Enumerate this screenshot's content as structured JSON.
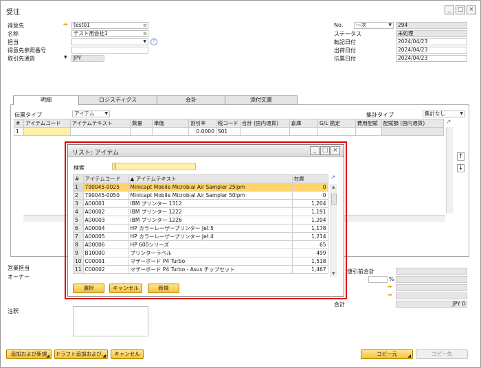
{
  "window": {
    "title": "受注"
  },
  "header_left": {
    "customer_label": "得意先",
    "customer_value": "test01",
    "name_label": "名称",
    "name_value": "テスト用会社1",
    "contact_label": "担当",
    "ref_label": "得意先参照番号",
    "currency_label": "取引先通貨",
    "currency_value": "JPY"
  },
  "header_right": {
    "no_label": "No.",
    "series_value": "一次",
    "no_value": "294",
    "status_label": "ステータス",
    "status_value": "未処理",
    "posting_label": "転記日付",
    "posting_value": "2024/04/23",
    "delivery_label": "出荷日付",
    "delivery_value": "2024/04/23",
    "doc_label": "伝票日付",
    "doc_value": "2024/04/23"
  },
  "tabs": [
    "明細",
    "ロジスティクス",
    "会計",
    "添付文書"
  ],
  "lines": {
    "doc_type_label": "伝票タイプ",
    "doc_type_value": "アイテム",
    "summary_label": "集計タイプ",
    "summary_value": "集計なし",
    "columns": [
      "#",
      "アイテムコード",
      "アイテムテキスト",
      "数量",
      "単価",
      "割引率",
      "税コード",
      "合計 (国内通貨)",
      "倉庫",
      "G/L 勘定",
      "費用配賦",
      "配賦額 (国内通貨)"
    ],
    "row": {
      "index": "1",
      "discount": "0.0000",
      "tax": "S01"
    }
  },
  "footer_left": {
    "sales_label": "営業担当",
    "owner_label": "オーナー",
    "remarks_label": "注釈"
  },
  "footer_right": {
    "total_before_label": "値引前合計",
    "pct": "%",
    "total_label": "合計",
    "total_value": "JPY 0"
  },
  "bottom_buttons": {
    "add_new": "追加および新規",
    "add_draft": "ドラフト追加および...",
    "cancel": "キャンセル",
    "copy_from": "コピー元",
    "copy_to": "コピー先"
  },
  "modal": {
    "title": "リスト: アイテム",
    "search_label": "検索",
    "columns": [
      "#",
      "アイテムコード",
      "アイテムテキスト",
      "在庫"
    ],
    "rows": [
      {
        "i": "1",
        "code": "790045-0025",
        "text": "Minicapt Mobile Microbial Air Sampler 25lpm",
        "stock": "0"
      },
      {
        "i": "2",
        "code": "790045-0050",
        "text": "Minicapt Mobile Microbial Air Sampler 50lpm",
        "stock": "0"
      },
      {
        "i": "3",
        "code": "A00001",
        "text": "IBM プリンター 1312",
        "stock": "1,204"
      },
      {
        "i": "4",
        "code": "A00002",
        "text": "IBM プリンター 1222",
        "stock": "1,191"
      },
      {
        "i": "5",
        "code": "A00003",
        "text": "IBM プリンター 1226",
        "stock": "1,204"
      },
      {
        "i": "6",
        "code": "A00004",
        "text": "HP カラーレーザープリンター Jet 5",
        "stock": "1,178"
      },
      {
        "i": "7",
        "code": "A00005",
        "text": "HP カラーレーザープリンター Jet 4",
        "stock": "1,214"
      },
      {
        "i": "8",
        "code": "A00006",
        "text": "HP 600シリーズ",
        "stock": "65"
      },
      {
        "i": "9",
        "code": "B10000",
        "text": "プリンターラベル",
        "stock": "499"
      },
      {
        "i": "10",
        "code": "C00001",
        "text": "マザーボード P4 Turbo",
        "stock": "1,518"
      },
      {
        "i": "11",
        "code": "C00002",
        "text": "マザーボード P4 Turbo - Asus チップセット",
        "stock": "1,467"
      }
    ],
    "buttons": {
      "select": "選択",
      "cancel": "キャンセル",
      "new": "新規"
    }
  },
  "colors": {
    "accent_yellow": "#f6c23d",
    "highlight_red": "#e00000",
    "selected_row": "#ffd46b"
  }
}
